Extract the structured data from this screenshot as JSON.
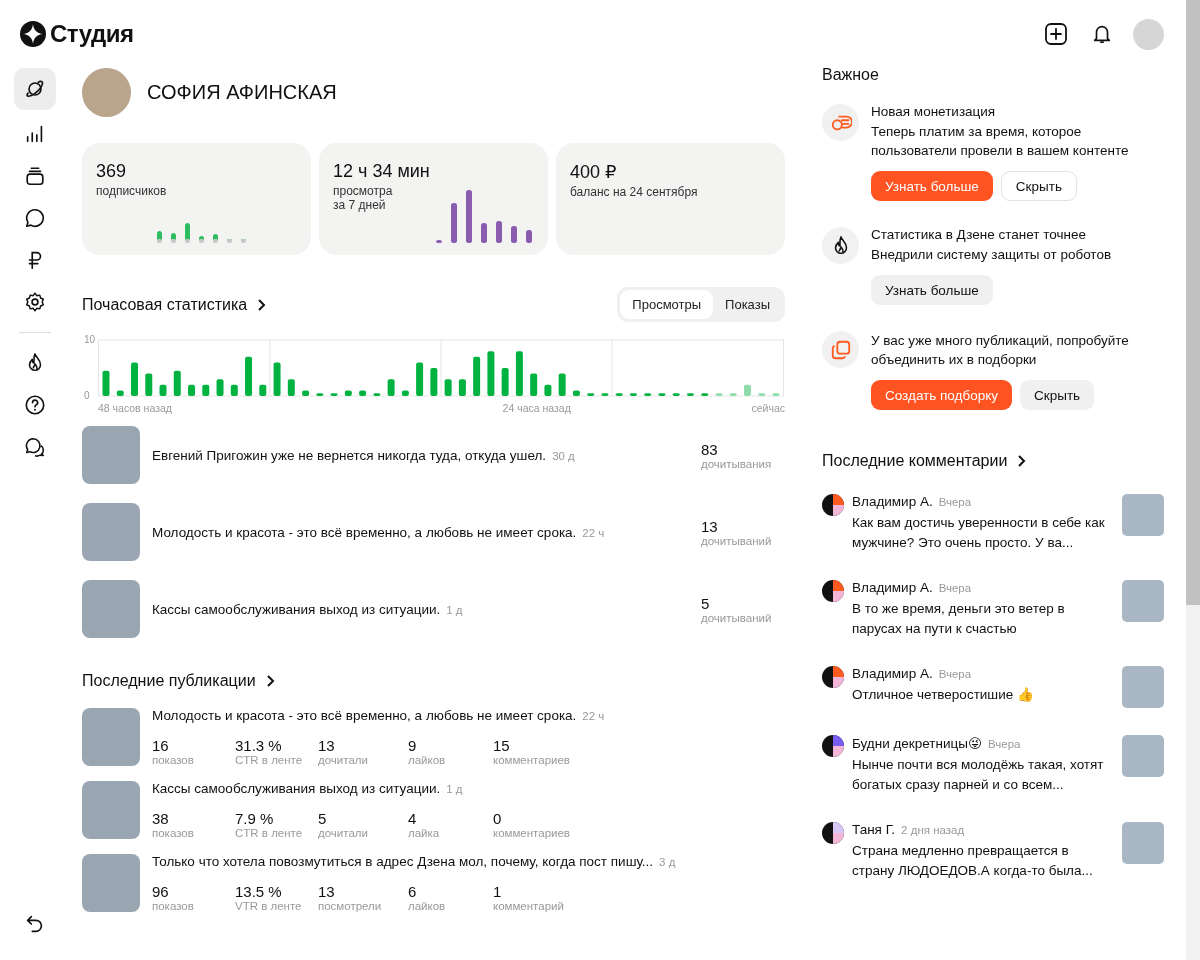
{
  "header": {
    "logo": "Студия"
  },
  "sidebar": {
    "items": [
      {
        "kind": "planet",
        "selected": true
      },
      {
        "kind": "stats",
        "selected": false
      },
      {
        "kind": "stack",
        "selected": false
      },
      {
        "kind": "chat",
        "selected": false
      },
      {
        "kind": "ruble",
        "selected": false
      },
      {
        "kind": "gear",
        "selected": false
      }
    ],
    "extra_items": [
      {
        "kind": "flame",
        "selected": false
      },
      {
        "kind": "help",
        "selected": false
      },
      {
        "kind": "chats",
        "selected": false
      }
    ],
    "footer_item": {
      "kind": "undo"
    }
  },
  "profile": {
    "name": "СОФИЯ АФИНСКАЯ"
  },
  "stat_cards": [
    {
      "kind": "subscribers",
      "value": "369",
      "label": "подписчиков"
    },
    {
      "kind": "views",
      "value": "12 ч 34 мин",
      "label": "просмотра",
      "sublabel": "за 7 дней"
    },
    {
      "kind": "balance",
      "value": "400 ₽",
      "label": "баланс на 24 сентября"
    }
  ],
  "hourly": {
    "title": "Почасовая статистика",
    "tabs": [
      {
        "label": "Просмотры",
        "selected": true
      },
      {
        "label": "Показы",
        "selected": false
      }
    ],
    "chart_data": {
      "type": "bar",
      "ylim": [
        0,
        10
      ],
      "yticks": [
        {
          "value": 0,
          "label": "0"
        },
        {
          "value": 10,
          "label": "10"
        }
      ],
      "categories": [
        null,
        null,
        null,
        null,
        null,
        null,
        null,
        null,
        null,
        null,
        null,
        null,
        null,
        null,
        null,
        null,
        null,
        null,
        null,
        null,
        null,
        null,
        null,
        null,
        null,
        null,
        null,
        null,
        null,
        null,
        null,
        null,
        null,
        null,
        null,
        null,
        null,
        null,
        null,
        null,
        null,
        null,
        null,
        null,
        null,
        null,
        null,
        null
      ],
      "series": [
        {
          "color": "#00b341",
          "values": [
            4.5,
            1,
            6,
            4,
            2,
            4.5,
            2,
            2,
            3,
            2,
            7,
            2,
            6,
            3,
            1,
            0.5,
            0.5,
            1,
            1,
            0.5,
            3,
            1,
            6,
            5,
            3,
            3,
            7,
            8,
            5,
            8,
            4,
            2,
            4,
            1,
            0.5,
            0.5,
            0.5,
            0.5,
            0.5,
            0.5,
            0.5,
            0.5,
            0.5,
            0,
            0,
            0,
            0,
            0
          ]
        },
        {
          "color": "#8fdcaa",
          "values": [
            0,
            0,
            0,
            0,
            0,
            0,
            0,
            0,
            0,
            0,
            0,
            0,
            0,
            0,
            0,
            0,
            0,
            0,
            0,
            0,
            0,
            0,
            0,
            0,
            0,
            0,
            0,
            0,
            0,
            0,
            0,
            0,
            0,
            0,
            0,
            0,
            0,
            0,
            0,
            0,
            0,
            0,
            0,
            0.5,
            0.5,
            2,
            0.5,
            0.5
          ]
        }
      ],
      "stacked": true
    },
    "axis_labels": [
      "48 часов назад",
      "24 часа назад",
      "сейчас"
    ]
  },
  "top_posts": [
    {
      "title": "Евгений Пригожин уже не вернется никогда туда, откуда ушел.",
      "age": "30 д",
      "value": "83",
      "unit": "дочитывания"
    },
    {
      "title": "Молодость и красота - это всё временно, а любовь не имеет срока.",
      "age": "22 ч",
      "value": "13",
      "unit": "дочитываний"
    },
    {
      "title": "Кассы самообслуживания выход из ситуации.",
      "age": "1 д",
      "value": "5",
      "unit": "дочитываний"
    }
  ],
  "publications": {
    "title": "Последние публикации",
    "items": [
      {
        "title": "Молодость и красота - это всё временно, а любовь не имеет срока.",
        "age": "22 ч",
        "stats": [
          {
            "value": "16",
            "label": "показов"
          },
          {
            "value": "31.3 %",
            "label": "CTR в ленте"
          },
          {
            "value": "13",
            "label": "дочитали"
          },
          {
            "value": "9",
            "label": "лайков"
          },
          {
            "value": "15",
            "label": "комментариев"
          }
        ]
      },
      {
        "title": "Кассы самообслуживания выход из ситуации.",
        "age": "1 д",
        "stats": [
          {
            "value": "38",
            "label": "показов"
          },
          {
            "value": "7.9 %",
            "label": "CTR в ленте"
          },
          {
            "value": "5",
            "label": "дочитали"
          },
          {
            "value": "4",
            "label": "лайка"
          },
          {
            "value": "0",
            "label": "комментариев"
          }
        ]
      },
      {
        "title": "Только что хотела повозмутиться в адрес Дзена мол, почему, когда пост пишу...",
        "age": "3 д",
        "stats": [
          {
            "value": "96",
            "label": "показов"
          },
          {
            "value": "13.5 %",
            "label": "VTR в ленте"
          },
          {
            "value": "13",
            "label": "посмотрели"
          },
          {
            "value": "6",
            "label": "лайков"
          },
          {
            "value": "1",
            "label": "комментарий"
          }
        ]
      }
    ]
  },
  "important": {
    "title": "Важное",
    "items": [
      {
        "kind": "coins",
        "title": "Новая монетизация",
        "text": "Теперь платим за время, которое пользователи провели в вашем контенте",
        "buttons": [
          {
            "label": "Узнать больше",
            "kind": "primary"
          },
          {
            "label": "Скрыть",
            "kind": "outline"
          }
        ]
      },
      {
        "kind": "flame",
        "title": "Статистика в Дзене станет точнее",
        "text": "Внедрили систему защиты от роботов",
        "buttons": [
          {
            "label": "Узнать больше",
            "kind": "secondary"
          }
        ]
      },
      {
        "kind": "copies",
        "text": "У вас уже много публикаций, попробуйте объединить их в подборки",
        "buttons": [
          {
            "label": "Создать подборку",
            "kind": "primary"
          },
          {
            "label": "Скрыть",
            "kind": "secondary"
          }
        ]
      }
    ]
  },
  "comments": {
    "title": "Последние комментарии",
    "items": [
      {
        "author": "Владимир А.",
        "time": "Вчера",
        "text": "Как вам достичь уверенности в себе как мужчине? Это очень просто. У ва...",
        "color": "#ff5a1f"
      },
      {
        "author": "Владимир А.",
        "time": "Вчера",
        "text": "В то же время, деньги это ветер в парусах на пути к счастью",
        "color": "#ff5a1f"
      },
      {
        "author": "Владимир А.",
        "time": "Вчера",
        "text": "Отличное четверостишие 👍",
        "color": "#ff5a1f"
      },
      {
        "author": "Будни декретницы😜",
        "time": "Вчера",
        "text": "Нынче почти вся молодёжь такая, хотят богатых сразу парней и со всем...",
        "color": "#7b5cf0"
      },
      {
        "author": "Таня Г.",
        "time": "2 дня назад",
        "text": "Страна медленно превращается в страну ЛЮДОЕДОВ.А когда-то была...",
        "color": "#d8c8f8"
      }
    ]
  }
}
